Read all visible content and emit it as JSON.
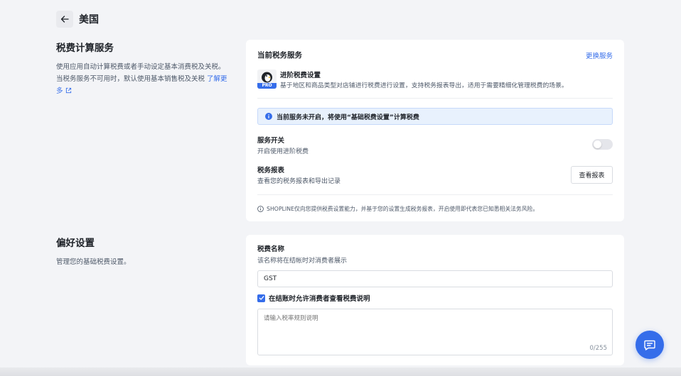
{
  "header": {
    "title": "美国"
  },
  "tax_service_section": {
    "title": "税费计算服务",
    "description": "使用应用自动计算税费或者手动设定基本消费税及关税。当税务服务不可用时，默认使用基本销售税及关税",
    "learn_more": "了解更多"
  },
  "current_service_card": {
    "title": "当前税务服务",
    "switch_link": "更换服务",
    "service": {
      "icon_badge": "PRO",
      "name": "进阶税费设置",
      "description": "基于地区和商品类型对店铺进行税费进行设置，支持税务报表导出，适用于需要精细化管理税费的场景。"
    },
    "notice": "当前服务未开启，将使用“基础税费设置”计算税费",
    "service_toggle": {
      "label": "服务开关",
      "sub": "开启使用进阶税费",
      "enabled": false
    },
    "tax_report": {
      "label": "税务报表",
      "sub": "查看您的税务报表和导出记录",
      "button": "查看报表"
    },
    "disclaimer": "SHOPLINE仅向您提供税费设置能力，并基于您的设置生成税务报表，开启使用即代表您已知悉相关法务风险。"
  },
  "preference_section": {
    "title": "偏好设置",
    "description": "管理您的基础税费设置。"
  },
  "preference_card": {
    "tax_name_label": "税费名称",
    "tax_name_sub": "该名称将在结帐时对消费者展示",
    "tax_name_value": "GST",
    "allow_view_label": "在结账时允许消费者查看税费说明",
    "allow_view_checked": true,
    "textarea_placeholder": "请输入税率规则说明",
    "counter": "0/255"
  },
  "colors": {
    "accent": "#356dea",
    "notice_bg": "#e8f1fd",
    "page_bg": "#f3f4f7"
  }
}
